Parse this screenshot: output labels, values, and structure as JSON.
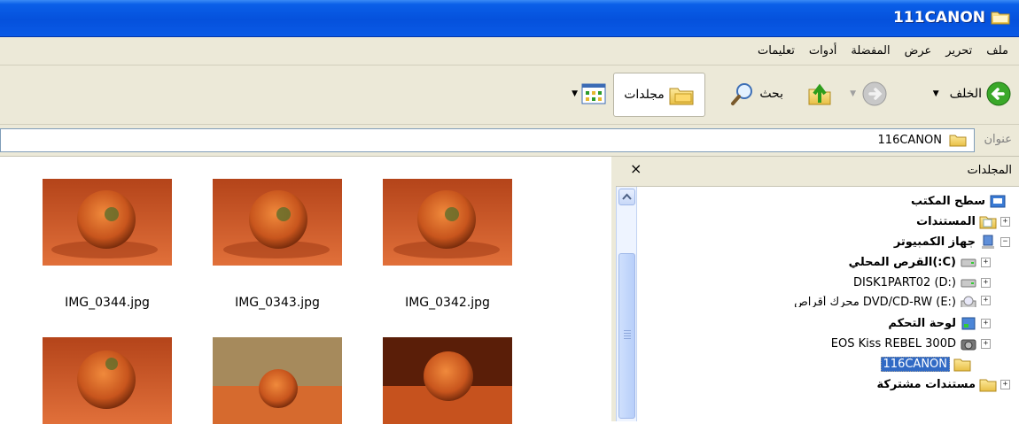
{
  "window": {
    "title": "111CANON"
  },
  "menu": [
    {
      "label": "ملف"
    },
    {
      "label": "تحرير"
    },
    {
      "label": "عرض"
    },
    {
      "label": "المفضلة"
    },
    {
      "label": "أدوات"
    },
    {
      "label": "تعليمات"
    }
  ],
  "toolbar": {
    "back_label": "الخلف",
    "search_label": "بحث",
    "folders_label": "مجلدات"
  },
  "address": {
    "label": "عنوان",
    "value": "116CANON"
  },
  "folders_pane": {
    "title": "المجلدات",
    "close": "×"
  },
  "tree": [
    {
      "label": "سطح المكتب"
    },
    {
      "label": "المستندات"
    },
    {
      "label": "جهاز الكمبيوتر"
    },
    {
      "label": "(C:)القرص المحلي"
    },
    {
      "label": "DISK1PART02 (D:)"
    },
    {
      "label": "DVD/CD-RW (E:) محرك أقراص"
    },
    {
      "label": "لوحة التحكم"
    },
    {
      "label": "EOS Kiss REBEL 300D"
    },
    {
      "label": "116CANON"
    },
    {
      "label": "مستندات مشتركة"
    }
  ],
  "files": [
    {
      "name": "IMG_0344.jpg"
    },
    {
      "name": "IMG_0343.jpg"
    },
    {
      "name": "IMG_0342.jpg"
    }
  ]
}
